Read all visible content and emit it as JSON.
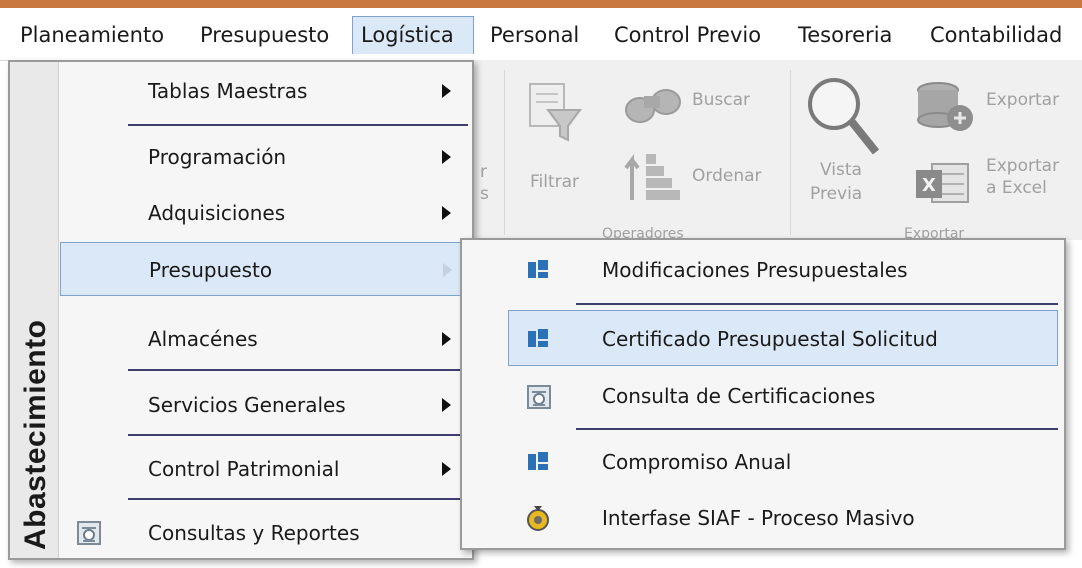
{
  "menubar": {
    "items": [
      {
        "label": "Planeamiento",
        "active": false
      },
      {
        "label": "Presupuesto",
        "active": false
      },
      {
        "label": "Logística",
        "active": true
      },
      {
        "label": "Personal",
        "active": false
      },
      {
        "label": "Control Previo",
        "active": false
      },
      {
        "label": "Tesoreria",
        "active": false
      },
      {
        "label": "Contabilidad",
        "active": false
      }
    ]
  },
  "ribbon": {
    "buscar": "Buscar",
    "filtrar": "Filtrar",
    "ordenar": "Ordenar",
    "operadores": "Operadores",
    "vista_previa_1": "Vista",
    "vista_previa_2": "Previa",
    "exportar": "Exportar",
    "exportar_excel_1": "Exportar",
    "exportar_excel_2": "a Excel",
    "exportar_group": "Exportar",
    "partial_1": "r",
    "partial_2": "s"
  },
  "dropdown": {
    "vertical_title": "Abastecimiento",
    "items": [
      {
        "label": "Tablas Maestras",
        "submenu": true,
        "icon": null
      },
      {
        "label": "Programación",
        "submenu": true,
        "icon": null
      },
      {
        "label": "Adquisiciones",
        "submenu": true,
        "icon": null
      },
      {
        "label": "Presupuesto",
        "submenu": true,
        "icon": null,
        "hover": true
      },
      {
        "label": "Almacénes",
        "submenu": true,
        "icon": null
      },
      {
        "label": "Servicios Generales",
        "submenu": true,
        "icon": null
      },
      {
        "label": "Control Patrimonial",
        "submenu": true,
        "icon": null
      },
      {
        "label": "Consultas y Reportes",
        "submenu": false,
        "icon": "report-icon"
      }
    ]
  },
  "submenu": {
    "items": [
      {
        "label": "Modificaciones Presupuestales",
        "icon": "module-icon"
      },
      {
        "label": "Certificado Presupuestal Solicitud",
        "icon": "module-icon",
        "hover": true
      },
      {
        "label": "Consulta de Certificaciones",
        "icon": "report-icon"
      },
      {
        "label": "Compromiso Anual",
        "icon": "module-icon"
      },
      {
        "label": "Interfase SIAF - Proceso Masivo",
        "icon": "process-icon"
      }
    ]
  },
  "colors": {
    "highlight_bg": "#dbe8f7",
    "highlight_border": "#7da2ce",
    "separator": "#3d3d6e",
    "module_icon": "#2a72b5",
    "top_strip": "#c9793f"
  }
}
